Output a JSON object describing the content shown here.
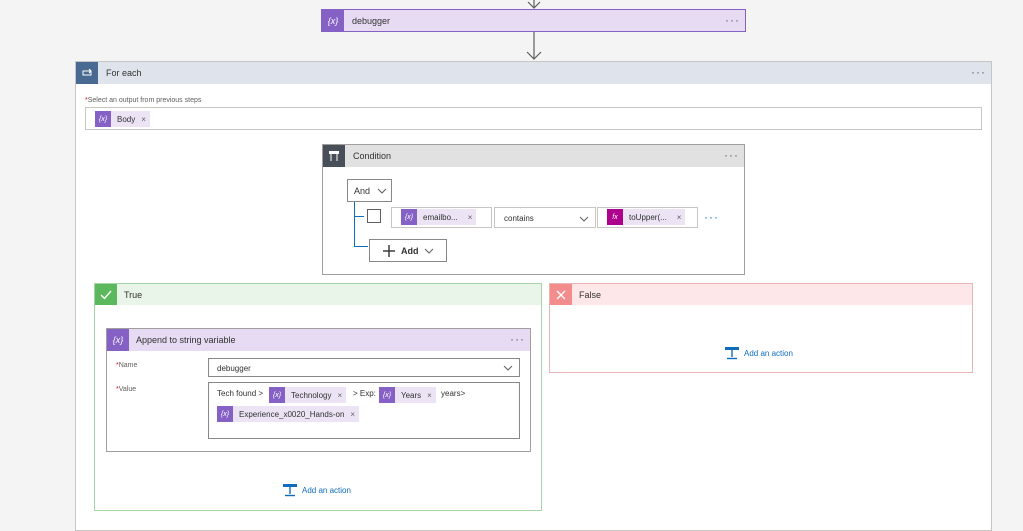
{
  "debugger_action": {
    "title": "debugger",
    "icon": "variable-icon",
    "more": "···"
  },
  "foreach": {
    "title": "For each",
    "icon": "loop-icon",
    "more": "···",
    "field_label": "Select an output from previous steps",
    "token": {
      "label": "Body",
      "remove": "×"
    }
  },
  "condition": {
    "title": "Condition",
    "icon": "condition-icon",
    "more": "···",
    "group_operator": "And",
    "row": {
      "left_token": "emailbo...",
      "operator": "contains",
      "right_token": "toUpper(...",
      "remove": "×",
      "more": "···"
    },
    "add_label": "Add"
  },
  "true_branch": {
    "title": "True",
    "action": {
      "title": "Append to string variable",
      "more": "···",
      "name_label": "Name",
      "name_value": "debugger",
      "value_label": "Value",
      "value_parts": {
        "text1": "Tech found >",
        "token1": "Technology",
        "text2": "> Exp:",
        "token2": "Years",
        "text3": "years>",
        "token3": "Experience_x0020_Hands-on",
        "remove": "×"
      }
    },
    "add_action": "Add an action"
  },
  "false_branch": {
    "title": "False",
    "add_action": "Add an action"
  },
  "colors": {
    "variable_purple": "#8661c5",
    "expression_magenta": "#ad008c",
    "loop_blue": "#486991",
    "condition_gray": "#484f58",
    "true_green": "#5cb85c",
    "false_red": "#f38c8c",
    "link_blue": "#0f6cbd"
  }
}
